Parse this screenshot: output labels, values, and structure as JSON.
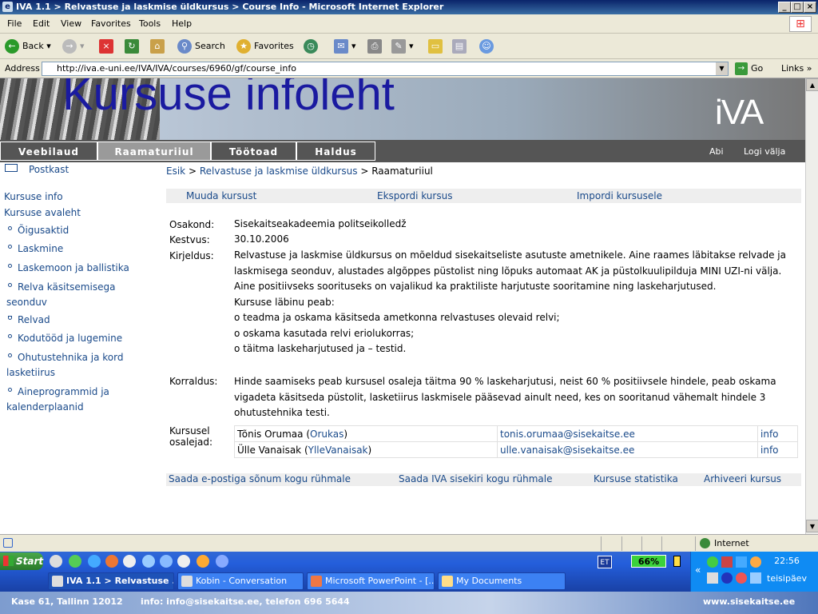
{
  "window": {
    "title": "IVA 1.1 > Relvastuse ja laskmise üldkursus > Course Info - Microsoft Internet Explorer"
  },
  "menu": [
    "File",
    "Edit",
    "View",
    "Favorites",
    "Tools",
    "Help"
  ],
  "toolbar": {
    "back": "Back",
    "search": "Search",
    "favorites": "Favorites"
  },
  "address": {
    "label": "Address",
    "url": "http://iva.e-uni.ee/IVA/IVA/courses/6960/gf/course_info",
    "go": "Go",
    "links": "Links"
  },
  "banner": {
    "title": "Kursuse infoleht",
    "logo": "iVA"
  },
  "nav": {
    "tabs": [
      "Veebilaud",
      "Raamaturiiul",
      "Töötoad",
      "Haldus"
    ],
    "help": "Abi",
    "logout": "Logi välja"
  },
  "leftnav": {
    "postkast": "Postkast",
    "course_info": "Kursuse info",
    "course_home": "Kursuse avaleht",
    "items": [
      "Õigusaktid",
      "Laskmine",
      "Laskemoon ja ballistika",
      "Relva käsitsemisega seonduv",
      "Relvad",
      "Kodutööd ja lugemine",
      "Ohutustehnika ja kord lasketiirus",
      "Aineprogrammid ja kalenderplaanid"
    ]
  },
  "breadcrumb": {
    "home": "Esik",
    "course": "Relvastuse ja laskmise üldkursus",
    "current": "Raamaturiiul",
    "sep": ">"
  },
  "actions": [
    "Muuda kursust",
    "Ekspordi kursus",
    "Impordi kursusele"
  ],
  "info": {
    "osakond_label": "Osakond:",
    "osakond": "Sisekaitseakadeemia politseikolledž",
    "kestvus_label": "Kestvus:",
    "kestvus": "30.10.2006",
    "kirjeldus_label": "Kirjeldus:",
    "kirjeldus_lines": [
      "Relvastuse ja laskmise üldkursus on mõeldud sisekaitseliste asutuste ametnikele. Aine raames läbitakse relvade ja laskmisega seonduv, alustades algõppes püstolist ning lõpuks automaat AK ja püstolkuulipilduja MINI UZI-ni välja. Aine positiivseks soorituseks on vajalikud ka praktiliste harjutuste sooritamine ning laskeharjutused.",
      "Kursuse läbinu peab:",
      "o teadma ja oskama käsitseda ametkonna relvastuses olevaid relvi;",
      "o oskama kasutada relvi eriolukorras;",
      "o täitma laskeharjutused ja – testid."
    ],
    "korraldus_label": "Korraldus:",
    "korraldus": "Hinde saamiseks peab kursusel osaleja täitma 90 % laskeharjutusi, neist 60 % positiivsele hindele, peab oskama vigadeta käsitseda püstolit, lasketiirus laskmisele pääsevad ainult need, kes on sooritanud vähemalt hindele 3 ohutustehnika testi.",
    "participants_label_1": "Kursusel",
    "participants_label_2": "osalejad:"
  },
  "participants": [
    {
      "name": "Tõnis Orumaa",
      "user": "Orukas",
      "email": "tonis.orumaa@sisekaitse.ee",
      "info": "info"
    },
    {
      "name": "Ülle Vanaisak",
      "user": "YlleVanaisak",
      "email": "ulle.vanaisak@sisekaitse.ee",
      "info": "info"
    }
  ],
  "bottom_actions": [
    "Saada e-postiga sõnum kogu rühmale",
    "Saada IVA sisekiri kogu rühmale",
    "Kursuse statistika",
    "Arhiveeri kursus"
  ],
  "statusbar": {
    "zone": "Internet"
  },
  "taskbar": {
    "start": "Start",
    "tasks": [
      "IVA 1.1 > Relvastuse ...",
      "Kobin - Conversation",
      "Microsoft PowerPoint - [...",
      "My Documents"
    ],
    "lang": "ET",
    "battery": "66%",
    "time": "22:56",
    "day": "teisipäev"
  },
  "footer": {
    "address": "Kase 61, Tallinn 12012",
    "contact": "info: info@sisekaitse.ee, telefon 696 5644",
    "site": "www.sisekaitse.ee"
  }
}
